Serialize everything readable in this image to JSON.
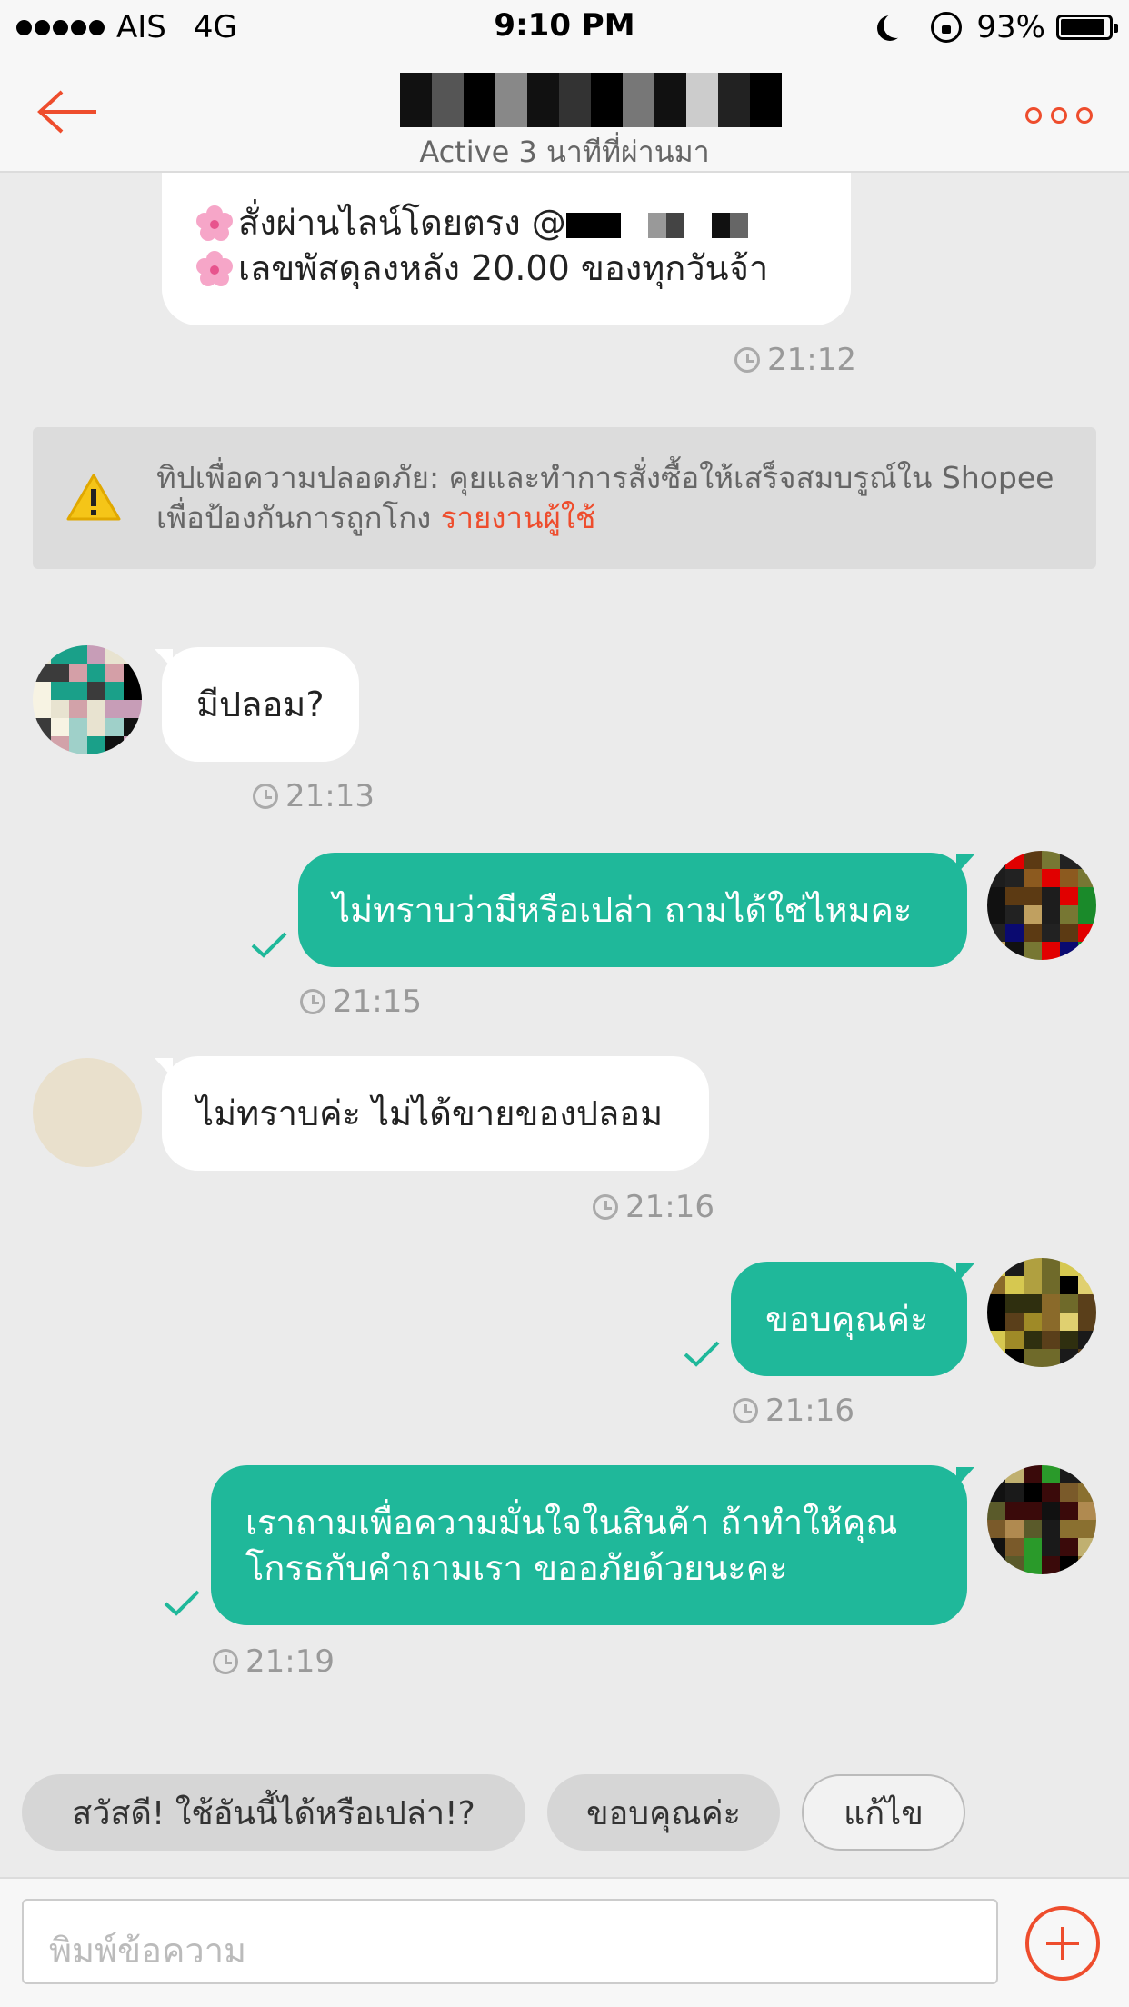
{
  "status_bar": {
    "carrier": "AIS",
    "network": "4G",
    "time": "9:10 PM",
    "battery": "93%",
    "battery_level": 0.93
  },
  "header": {
    "subtitle": "Active 3 นาทีที่ผ่านมา"
  },
  "messages": [
    {
      "side": "in",
      "lines": [
        "สั่งผ่านไลน์โดยตรง @",
        "เลขพัสดุลงหลัง 20.00 ของทุกวันจ้า"
      ],
      "time": "21:12"
    },
    {
      "side": "in",
      "text": "มีปลอม?",
      "time": "21:13"
    },
    {
      "side": "out",
      "text": "ไม่ทราบว่ามีหรือเปล่า ถามได้ใช่ไหมคะ",
      "time": "21:15"
    },
    {
      "side": "in",
      "text": "ไม่ทราบค่ะ ไม่ได้ขายของปลอม",
      "time": "21:16"
    },
    {
      "side": "out",
      "text": "ขอบคุณค่ะ",
      "time": "21:16"
    },
    {
      "side": "out",
      "lines": [
        "เราถามเพื่อความมั่นใจในสินค้า ถ้าทำให้คุณ",
        "โกรธกับคำถามเรา ขออภัยด้วยนะคะ"
      ],
      "time": "21:19"
    }
  ],
  "tip": {
    "text": "ทิปเพื่อความปลอดภัย: คุยและทำการสั่งซื้อให้เสร็จสมบรูณ์ใน Shopee เพื่อป้องกันการถูกโกง",
    "link": "รายงานผู้ใช้"
  },
  "quick_replies": [
    "สวัสดี! ใช้อันนี้ได้หรือเปล่า!?",
    "ขอบคุณค่ะ",
    "แก้ไข"
  ],
  "input": {
    "placeholder": "พิมพ์ข้อความ"
  },
  "colors": {
    "accent": "#ee4d2d",
    "outgoing_bubble": "#1fb89a",
    "incoming_bubble": "#ffffff",
    "background": "#ebebeb"
  },
  "icons": [
    "back-arrow-icon",
    "more-icon",
    "clock-icon",
    "check-icon",
    "warning-icon",
    "plus-icon",
    "flower-icon"
  ]
}
